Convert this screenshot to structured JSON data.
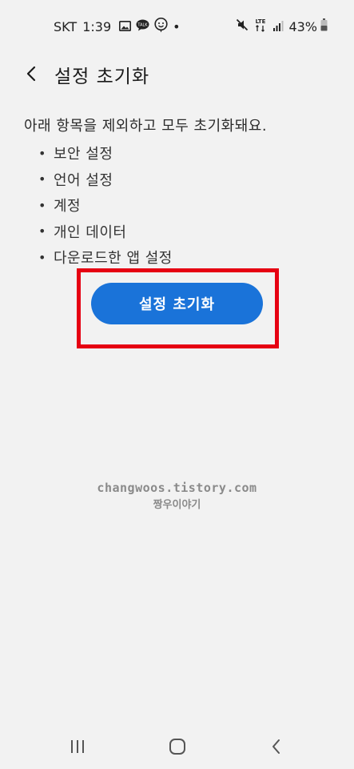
{
  "status_bar": {
    "carrier": "SKT",
    "time": "1:39",
    "dot": "•",
    "network": "LTE",
    "battery": "43%",
    "icons": [
      "gallery-icon",
      "talk-icon",
      "face-icon",
      "mute-icon",
      "lte-icon",
      "signal-icon",
      "battery-icon"
    ]
  },
  "header": {
    "title": "설정 초기화"
  },
  "content": {
    "intro": "아래 항목을 제외하고 모두 초기화돼요.",
    "bullet": "•",
    "items": [
      "보안 설정",
      "언어 설정",
      "계정",
      "개인 데이터",
      "다운로드한 앱 설정"
    ]
  },
  "action": {
    "reset_label": "설정 초기화"
  },
  "watermark": {
    "url": "changwoos.tistory.com",
    "name": "짱우이야기"
  },
  "colors": {
    "accent": "#1a73d9",
    "highlight": "#e60012",
    "background": "#f2f2f2"
  }
}
